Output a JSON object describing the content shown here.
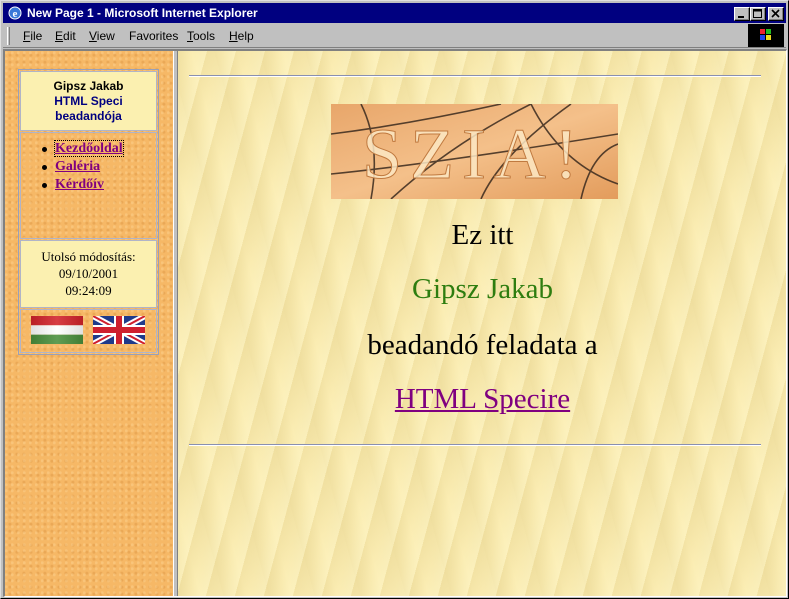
{
  "window": {
    "title": "New Page 1 - Microsoft Internet Explorer"
  },
  "menubar": {
    "items": [
      {
        "label": "File",
        "accel": "F",
        "rest": "ile"
      },
      {
        "label": "Edit",
        "accel": "E",
        "rest": "dit"
      },
      {
        "label": "View",
        "accel": "V",
        "rest": "iew"
      },
      {
        "label": "Favorites",
        "accel": "",
        "rest": "Favorites"
      },
      {
        "label": "Tools",
        "accel": "T",
        "rest": "ools"
      },
      {
        "label": "Help",
        "accel": "H",
        "rest": "elp"
      }
    ]
  },
  "sidebar": {
    "title_line1": "Gipsz Jakab",
    "title_line2": "HTML Speci",
    "title_line3": "beadandója",
    "links": [
      {
        "label": "Kezdőoldal"
      },
      {
        "label": "Galéria"
      },
      {
        "label": "Kérdőív"
      }
    ],
    "modified_label": "Utolsó módosítás:",
    "modified_date": "09/10/2001",
    "modified_time": "09:24:09",
    "flags": [
      "hungarian-flag-icon",
      "uk-flag-icon"
    ]
  },
  "main": {
    "banner_text": "SZIA!",
    "line1": "Ez itt",
    "line2": "Gipsz Jakab",
    "line3": "beadandó feladata a",
    "line4": "HTML Specire"
  },
  "colors": {
    "titlebar": "#000080",
    "link_visited": "#800080",
    "name_green": "#2e7d10",
    "sidebar_bg": "#f6b866",
    "main_bg": "#fbedb3"
  }
}
